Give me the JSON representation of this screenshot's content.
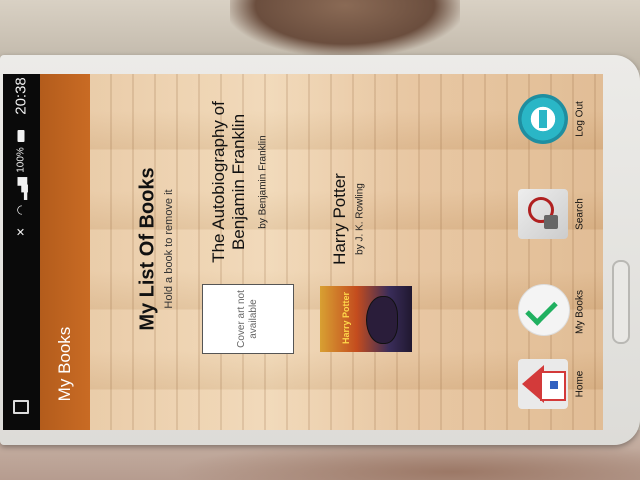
{
  "status_bar": {
    "time": "20:38",
    "battery": "100%",
    "icons": [
      "battery-icon",
      "signal-icon",
      "wifi-icon",
      "mute-icon",
      "notification-icon"
    ]
  },
  "action_bar": {
    "title": "My Books",
    "color": "#c0641f"
  },
  "page": {
    "title": "My List Of Books",
    "hint": "Hold a book to remove it"
  },
  "books": [
    {
      "title_line1": "The Autobiography of",
      "title_line2": "Benjamin Franklin",
      "author": "by   Benjamin Franklin",
      "cover_placeholder": "Cover art not available"
    },
    {
      "title": "Harry Potter",
      "author": "by   J. K. Rowling",
      "cover_text": "Harry Potter"
    }
  ],
  "nav": [
    {
      "label": "Log Out",
      "icon": "logout-icon"
    },
    {
      "label": "Search",
      "icon": "search-icon"
    },
    {
      "label": "My Books",
      "icon": "checkmark-icon"
    },
    {
      "label": "Home",
      "icon": "home-icon"
    }
  ]
}
